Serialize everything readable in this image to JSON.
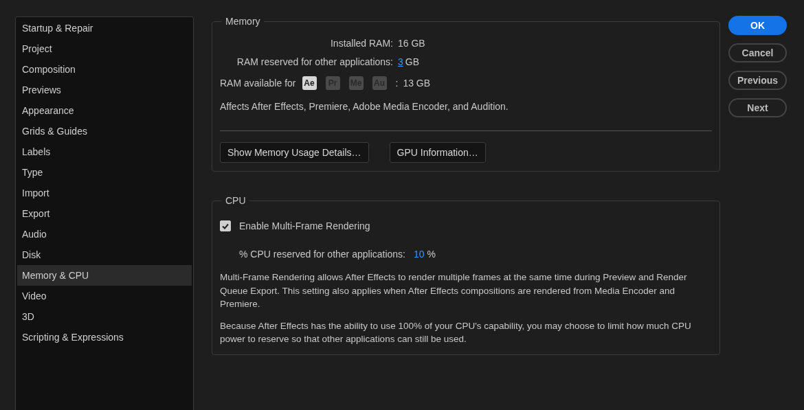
{
  "sidebar": {
    "items": [
      {
        "label": "Startup & Repair",
        "selected": false
      },
      {
        "label": "Project",
        "selected": false
      },
      {
        "label": "Composition",
        "selected": false
      },
      {
        "label": "Previews",
        "selected": false
      },
      {
        "label": "Appearance",
        "selected": false
      },
      {
        "label": "Grids & Guides",
        "selected": false
      },
      {
        "label": "Labels",
        "selected": false
      },
      {
        "label": "Type",
        "selected": false
      },
      {
        "label": "Import",
        "selected": false
      },
      {
        "label": "Export",
        "selected": false
      },
      {
        "label": "Audio",
        "selected": false
      },
      {
        "label": "Disk",
        "selected": false
      },
      {
        "label": "Memory & CPU",
        "selected": true
      },
      {
        "label": "Video",
        "selected": false
      },
      {
        "label": "3D",
        "selected": false
      },
      {
        "label": "Scripting & Expressions",
        "selected": false
      }
    ]
  },
  "memory": {
    "title": "Memory",
    "installed_ram": {
      "label": "Installed RAM:",
      "value": "16 GB"
    },
    "reserved": {
      "label": "RAM reserved for other applications:",
      "value": "3",
      "unit": "GB"
    },
    "available": {
      "label": "RAM available for",
      "apps": [
        {
          "label": "Ae",
          "on": true
        },
        {
          "label": "Pr",
          "on": false
        },
        {
          "label": "Me",
          "on": false
        },
        {
          "label": "Au",
          "on": false
        }
      ],
      "separator": ":",
      "value": "13 GB"
    },
    "note": "Affects After Effects, Premiere, Adobe Media Encoder, and Audition.",
    "buttons": [
      "Show Memory Usage Details…",
      "GPU Information…"
    ]
  },
  "cpu": {
    "title": "CPU",
    "multi_frame": {
      "label": "Enable Multi-Frame Rendering",
      "checked": true
    },
    "reserved": {
      "label": "% CPU reserved for other applications:",
      "value": "10",
      "unit": "%"
    },
    "paragraphs": [
      "Multi-Frame Rendering allows After Effects to render multiple frames at the same time during Preview and Render Queue Export. This setting also applies when After Effects compositions are rendered from Media Encoder and Premiere.",
      "Because After Effects has the ability to use 100% of your CPU's capability, you may choose to limit how much CPU power to reserve so that other applications can still be used."
    ]
  },
  "buttons": [
    {
      "label": "OK",
      "kind": "primary"
    },
    {
      "label": "Cancel",
      "kind": "secondary"
    },
    {
      "label": "Previous",
      "kind": "secondary"
    },
    {
      "label": "Next",
      "kind": "secondary"
    }
  ]
}
